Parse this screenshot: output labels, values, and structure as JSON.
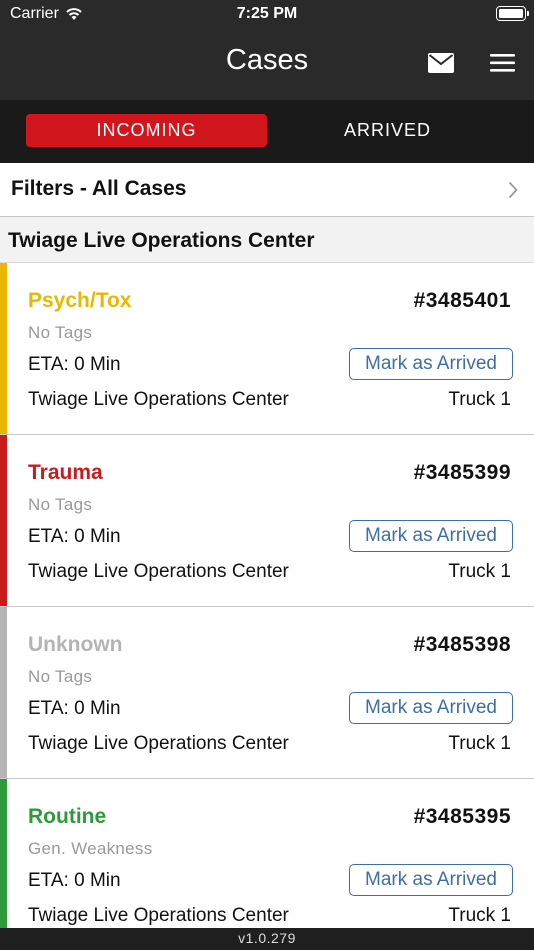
{
  "status_bar": {
    "carrier": "Carrier",
    "time": "7:25 PM"
  },
  "nav": {
    "title": "Cases",
    "mail_icon": "mail-icon",
    "menu_icon": "menu-icon"
  },
  "tabs": [
    {
      "label": "INCOMING",
      "active": true
    },
    {
      "label": "ARRIVED",
      "active": false
    }
  ],
  "filters": {
    "label": "Filters - All Cases"
  },
  "section": {
    "title": "Twiage Live Operations Center"
  },
  "cases": [
    {
      "type": "Psych/Tox",
      "type_color": "#e8b800",
      "number": "#3485401",
      "tags": "No Tags",
      "eta": "ETA: 0 Min",
      "action": "Mark as Arrived",
      "center": "Twiage Live Operations Center",
      "unit": "Truck 1"
    },
    {
      "type": "Trauma",
      "type_color": "#c81c1c",
      "number": "#3485399",
      "tags": "No Tags",
      "eta": "ETA: 0 Min",
      "action": "Mark as Arrived",
      "center": "Twiage Live Operations Center",
      "unit": "Truck 1"
    },
    {
      "type": "Unknown",
      "type_color": "#b4b4b4",
      "number": "#3485398",
      "tags": "No Tags",
      "eta": "ETA: 0 Min",
      "action": "Mark as Arrived",
      "center": "Twiage Live Operations Center",
      "unit": "Truck 1"
    },
    {
      "type": "Routine",
      "type_color": "#2e9a3c",
      "number": "#3485395",
      "tags": "Gen. Weakness",
      "eta": "ETA: 0 Min",
      "action": "Mark as Arrived",
      "center": "Twiage Live Operations Center",
      "unit": "Truck 1"
    }
  ],
  "footer": {
    "version": "v1.0.279"
  },
  "colors": {
    "header_bg": "#2a2a2a",
    "active_tab": "#d0161c",
    "button_blue": "#3f6ea6"
  }
}
